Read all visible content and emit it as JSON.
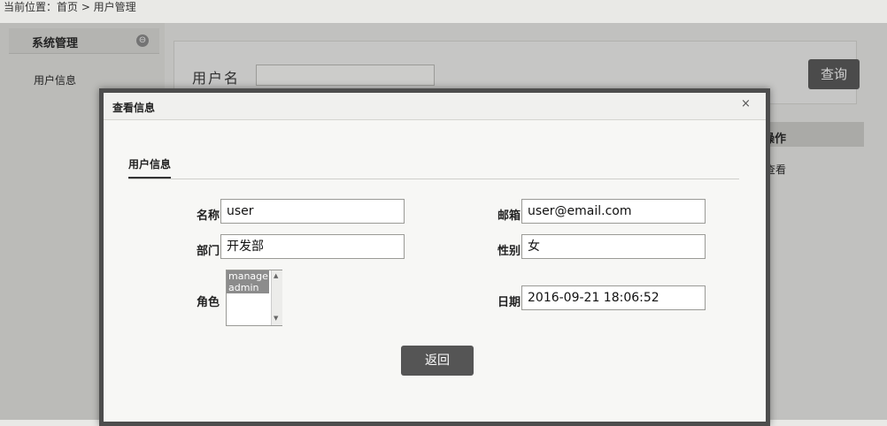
{
  "breadcrumb": "当前位置：首页 > 用户管理",
  "sidebar": {
    "header": "系统管理",
    "toggle_symbol": "⊖",
    "items": [
      {
        "label": "用户信息"
      }
    ]
  },
  "search": {
    "label": "用户名",
    "value": "",
    "button": "查询"
  },
  "table": {
    "operations_header": "操作",
    "view_link": "查看"
  },
  "modal": {
    "title": "查看信息",
    "close_symbol": "×",
    "tab": "用户信息",
    "fields": {
      "name_label": "名称",
      "name_value": "user",
      "email_label": "邮箱",
      "email_value": "user@email.com",
      "department_label": "部门",
      "department_value": "开发部",
      "gender_label": "性别",
      "gender_value": "女",
      "role_label": "角色",
      "roles": [
        "manage",
        "admin"
      ],
      "date_label": "日期",
      "date_value": "2016-09-21 18:06:52"
    },
    "back_button": "返回"
  },
  "colors": {
    "dark_button": "#555555",
    "modal_border": "#4d4d4d",
    "selected_option": "#8c8c8c"
  }
}
